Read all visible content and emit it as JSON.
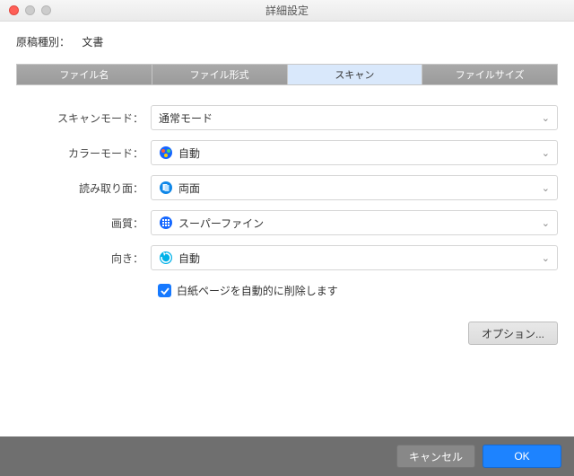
{
  "window": {
    "title": "詳細設定"
  },
  "header": {
    "label": "原稿種別：",
    "value": "文書"
  },
  "tabs": {
    "items": [
      {
        "id": "filename",
        "label": "ファイル名"
      },
      {
        "id": "fileformat",
        "label": "ファイル形式"
      },
      {
        "id": "scan",
        "label": "スキャン"
      },
      {
        "id": "filesize",
        "label": "ファイルサイズ"
      }
    ],
    "active": "scan"
  },
  "form": {
    "scan_mode": {
      "label": "スキャンモード：",
      "value": "通常モード"
    },
    "color_mode": {
      "label": "カラーモード：",
      "value": "自動",
      "icon": "auto-color-icon"
    },
    "read_side": {
      "label": "読み取り面：",
      "value": "両面",
      "icon": "duplex-icon"
    },
    "quality": {
      "label": "画質：",
      "value": "スーパーファイン",
      "icon": "quality-grid-icon"
    },
    "orientation": {
      "label": "向き：",
      "value": "自動",
      "icon": "rotate-icon"
    },
    "blank_remove": {
      "checked": true,
      "label": "白紙ページを自動的に削除します"
    }
  },
  "option_button": "オプション...",
  "footer": {
    "cancel": "キャンセル",
    "ok": "OK"
  },
  "colors": {
    "accent": "#1d83ff"
  }
}
